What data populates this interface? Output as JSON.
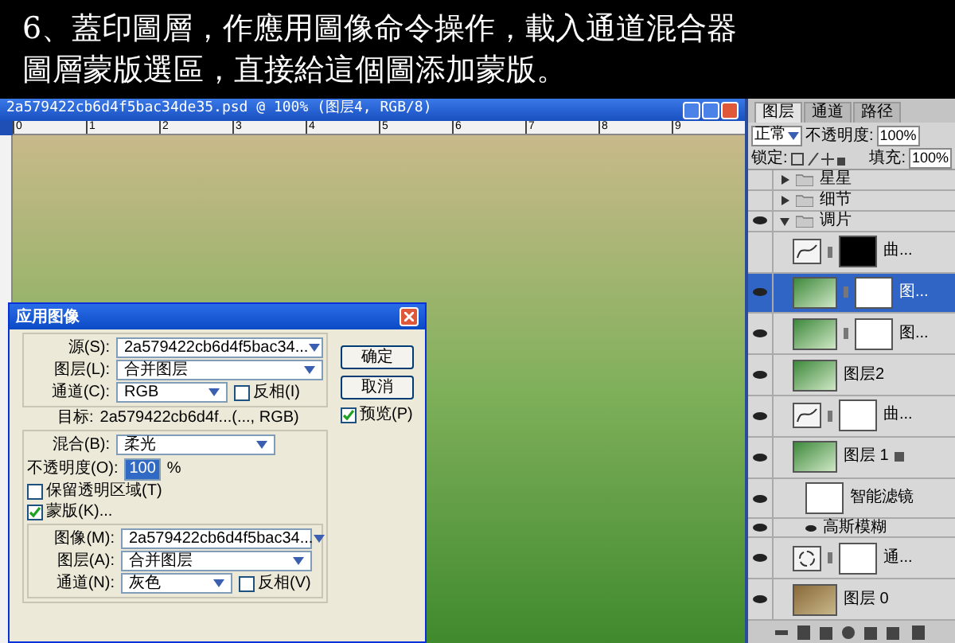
{
  "caption_lines": [
    "6、蓋印圖層，作應用圖像命令操作，載入通道混合器",
    "圖層蒙版選區，直接給這個圖添加蒙版。"
  ],
  "document": {
    "title": "2a579422cb6d4f5bac34de35.psd @ 100% (图层4, RGB/8)",
    "ruler_marks": [
      "0",
      "1",
      "2",
      "3",
      "4",
      "5",
      "6",
      "7",
      "8",
      "9"
    ]
  },
  "dialog": {
    "title": "应用图像",
    "source": {
      "label": "源(S):",
      "value": "2a579422cb6d4f5bac34..."
    },
    "layer": {
      "label": "图层(L):",
      "value": "合并图层"
    },
    "channel": {
      "label": "通道(C):",
      "value": "RGB"
    },
    "invert": {
      "label": "反相(I)",
      "checked": false
    },
    "target": {
      "label": "目标:",
      "value": "2a579422cb6d4f...(..., RGB)"
    },
    "blending": {
      "label": "混合(B):",
      "value": "柔光"
    },
    "opacity": {
      "label": "不透明度(O):",
      "value": "100",
      "unit": "%"
    },
    "preserve_transparency": {
      "label": "保留透明区域(T)",
      "checked": false
    },
    "mask": {
      "label": "蒙版(K)...",
      "checked": true
    },
    "mask_image": {
      "label": "图像(M):",
      "value": "2a579422cb6d4f5bac34..."
    },
    "mask_layer": {
      "label": "图层(A):",
      "value": "合并图层"
    },
    "mask_channel": {
      "label": "通道(N):",
      "value": "灰色"
    },
    "mask_invert": {
      "label": "反相(V)",
      "checked": false
    },
    "buttons": [
      "确定",
      "取消"
    ],
    "preview": {
      "label": "预览(P)",
      "checked": true
    }
  },
  "layers_panel": {
    "tabs": [
      {
        "label": "图层",
        "selected": true
      },
      {
        "label": "通道",
        "selected": false
      },
      {
        "label": "路径",
        "selected": false
      }
    ],
    "blend_mode": "正常",
    "opacity": {
      "label": "不透明度:",
      "value": "100%"
    },
    "lock_label": "锁定:",
    "fill": {
      "label": "填充:",
      "value": "100%"
    },
    "layers": [
      {
        "kind": "folder",
        "name": "星星",
        "visible": false,
        "selected": false,
        "expanded": false
      },
      {
        "kind": "folder",
        "name": "细节",
        "visible": false,
        "selected": false,
        "expanded": false
      },
      {
        "kind": "folder",
        "name": "调片",
        "visible": true,
        "selected": false,
        "expanded": true,
        "children": [
          {
            "kind": "curves",
            "name": "曲...",
            "visible": false,
            "selected": false,
            "mask": true,
            "mask_filled": true
          },
          {
            "kind": "layer",
            "name": "图...",
            "visible": true,
            "selected": true,
            "mask": true,
            "mask_filled": false
          },
          {
            "kind": "layer",
            "name": "图...",
            "visible": true,
            "selected": false,
            "mask": true,
            "mask_filled": false
          },
          {
            "kind": "layer",
            "name": "图层2",
            "visible": true,
            "selected": false
          },
          {
            "kind": "curves",
            "name": "曲...",
            "visible": true,
            "selected": false,
            "mask": true,
            "mask_filled": false
          },
          {
            "kind": "smart_layer",
            "name": "图层 1",
            "visible": true,
            "selected": false,
            "children": [
              {
                "kind": "smart_filters",
                "name": "智能滤镜",
                "visible": true,
                "selected": false,
                "mask": true,
                "mask_filled": false
              },
              {
                "kind": "filter",
                "name": "高斯模糊",
                "visible": true,
                "selected": false
              }
            ]
          },
          {
            "kind": "channel_mixer",
            "name": "通...",
            "visible": true,
            "selected": false,
            "mask": true,
            "mask_filled": false
          },
          {
            "kind": "base_layer",
            "name": "图层 0",
            "visible": true,
            "selected": false
          }
        ]
      }
    ]
  }
}
